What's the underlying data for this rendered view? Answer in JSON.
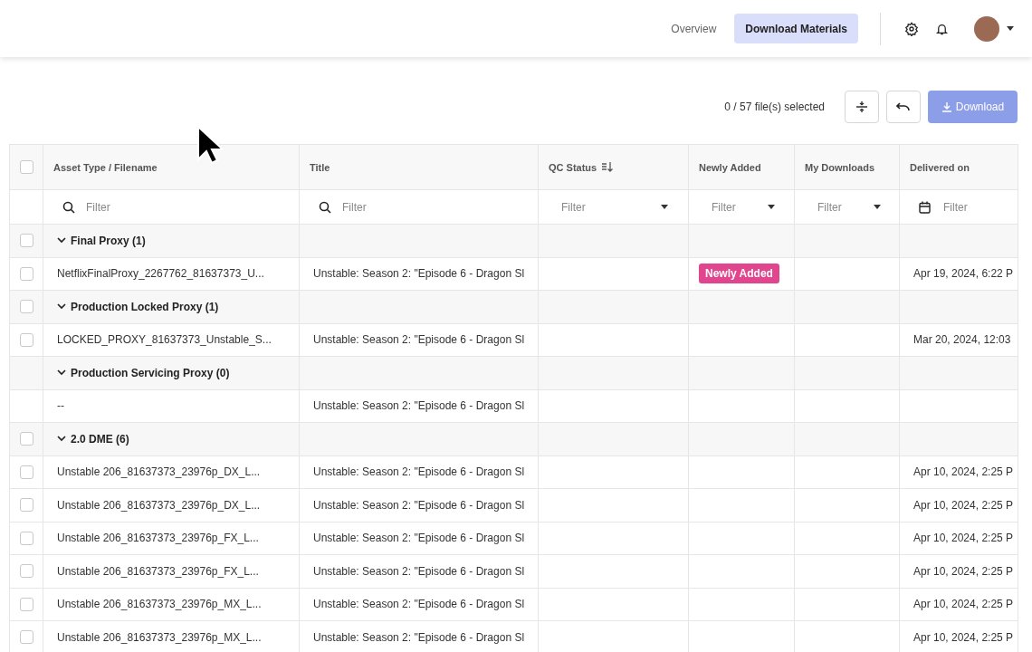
{
  "nav": {
    "tabs": [
      {
        "label": "Overview",
        "selected": false
      },
      {
        "label": "Download Materials",
        "selected": true
      }
    ]
  },
  "toolbar": {
    "selection": "0 / 57 file(s) selected",
    "download": {
      "label": "Download",
      "disabled": true
    }
  },
  "table": {
    "header_checked": false,
    "columns": [
      {
        "label": "Asset Type / Filename",
        "sorted": false,
        "filter": {
          "kind": "search",
          "placeholder": "Filter"
        }
      },
      {
        "label": "Title",
        "sorted": false,
        "filter": {
          "kind": "search",
          "placeholder": "Filter"
        }
      },
      {
        "label": "QC Status",
        "sorted": true,
        "filter": {
          "kind": "select",
          "placeholder": "Filter"
        }
      },
      {
        "label": "Newly Added",
        "sorted": false,
        "filter": {
          "kind": "select",
          "placeholder": "Filter"
        }
      },
      {
        "label": "My Downloads",
        "sorted": false,
        "filter": {
          "kind": "select",
          "placeholder": "Filter"
        }
      },
      {
        "label": "Delivered on",
        "sorted": false,
        "filter": {
          "kind": "date",
          "placeholder": "Filter"
        }
      }
    ],
    "rows": [
      {
        "kind": "group",
        "label": "Final Proxy (1)",
        "expanded": true,
        "checked": false
      },
      {
        "kind": "file",
        "checked": false,
        "filename": "NetflixFinalProxy_2267762_81637373_U...",
        "title": "Unstable: Season 2: \"Episode 6 - Dragon Sl",
        "badge": "Newly Added",
        "delivered": "Apr 19, 2024, 6:22 P"
      },
      {
        "kind": "group",
        "label": "Production Locked Proxy (1)",
        "expanded": true,
        "checked": false
      },
      {
        "kind": "file",
        "checked": false,
        "filename": "LOCKED_PROXY_81637373_Unstable_S...",
        "title": "Unstable: Season 2: \"Episode 6 - Dragon Sl",
        "delivered": "Mar 20, 2024, 12:03"
      },
      {
        "kind": "group",
        "label": "Production Servicing Proxy (0)",
        "expanded": true
      },
      {
        "kind": "file",
        "filename": "--",
        "title": "Unstable: Season 2: \"Episode 6 - Dragon Sl"
      },
      {
        "kind": "group",
        "label": "2.0 DME (6)",
        "expanded": true,
        "checked": false
      },
      {
        "kind": "file",
        "checked": false,
        "filename": "Unstable 206_81637373_23976p_DX_L...",
        "title": "Unstable: Season 2: \"Episode 6 - Dragon Sl",
        "delivered": "Apr 10, 2024, 2:25 P"
      },
      {
        "kind": "file",
        "checked": false,
        "filename": "Unstable 206_81637373_23976p_DX_L...",
        "title": "Unstable: Season 2: \"Episode 6 - Dragon Sl",
        "delivered": "Apr 10, 2024, 2:25 P"
      },
      {
        "kind": "file",
        "checked": false,
        "filename": "Unstable 206_81637373_23976p_FX_L...",
        "title": "Unstable: Season 2: \"Episode 6 - Dragon Sl",
        "delivered": "Apr 10, 2024, 2:25 P"
      },
      {
        "kind": "file",
        "checked": false,
        "filename": "Unstable 206_81637373_23976p_FX_L...",
        "title": "Unstable: Season 2: \"Episode 6 - Dragon Sl",
        "delivered": "Apr 10, 2024, 2:25 P"
      },
      {
        "kind": "file",
        "checked": false,
        "filename": "Unstable 206_81637373_23976p_MX_L...",
        "title": "Unstable: Season 2: \"Episode 6 - Dragon Sl",
        "delivered": "Apr 10, 2024, 2:25 P"
      },
      {
        "kind": "file",
        "checked": false,
        "filename": "Unstable 206_81637373_23976p_MX_L...",
        "title": "Unstable: Season 2: \"Episode 6 - Dragon Sl",
        "delivered": "Apr 10, 2024, 2:25 P"
      }
    ]
  }
}
